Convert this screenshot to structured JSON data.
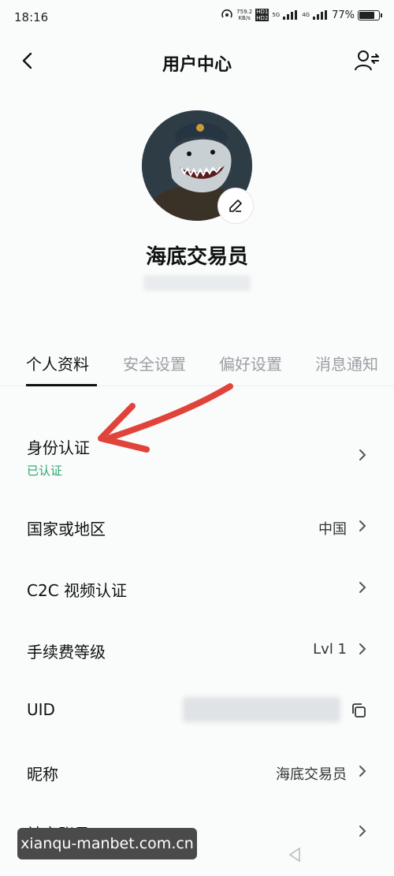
{
  "status_bar": {
    "time": "18:16",
    "speed": "759.2",
    "speed_unit": "KB/s",
    "hd1": "HD1",
    "hd2": "HD2",
    "net1": "5G",
    "net2": "4G",
    "battery": "77%"
  },
  "header": {
    "title": "用户中心"
  },
  "profile": {
    "nickname": "海底交易员"
  },
  "tabs": [
    {
      "label": "个人资料",
      "active": true
    },
    {
      "label": "安全设置",
      "active": false
    },
    {
      "label": "偏好设置",
      "active": false
    },
    {
      "label": "消息通知",
      "active": false
    }
  ],
  "rows": {
    "identity": {
      "label": "身份认证",
      "status": "已认证"
    },
    "country": {
      "label": "国家或地区",
      "value": "中国"
    },
    "c2c_video": {
      "label": "C2C 视频认证"
    },
    "fee_level": {
      "label": "手续费等级",
      "value": "Lvl 1"
    },
    "uid": {
      "label": "UID"
    },
    "nickname": {
      "label": "昵称",
      "value": "海底交易员"
    },
    "social": {
      "label": "社交账号"
    }
  },
  "watermark": {
    "text": "xianqu-manbet.com.cn"
  },
  "colors": {
    "verified": "#2aa56a",
    "arrow": "#e0433a",
    "accent": "#111111"
  }
}
